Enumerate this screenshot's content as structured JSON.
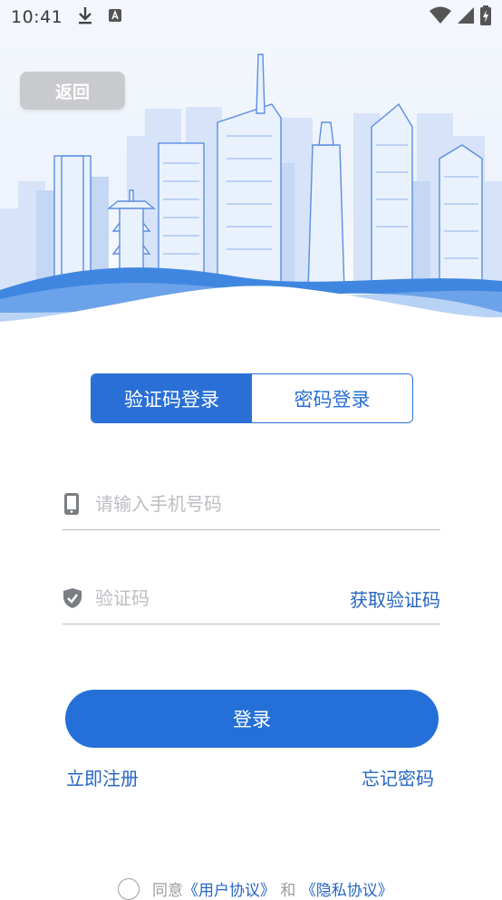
{
  "status_bar": {
    "time": "10:41",
    "icons_left": [
      "download-icon",
      "a-notification-icon"
    ],
    "icons_right": [
      "wifi-icon",
      "cell-signal-icon",
      "battery-charging-icon"
    ]
  },
  "header": {
    "back_label": "返回"
  },
  "tabs": [
    {
      "label": "验证码登录",
      "active": true
    },
    {
      "label": "密码登录",
      "active": false
    }
  ],
  "form": {
    "phone": {
      "placeholder": "请输入手机号码",
      "value": "",
      "icon": "phone-icon"
    },
    "code": {
      "placeholder": "验证码",
      "value": "",
      "icon": "shield-check-icon",
      "action_label": "获取验证码"
    }
  },
  "login_label": "登录",
  "links": {
    "register": "立即注册",
    "forgot": "忘记密码"
  },
  "agreement": {
    "prefix": "同意",
    "user_protocol": "《用户协议》",
    "conjunction": "和",
    "privacy_protocol": "《隐私协议》"
  },
  "colors": {
    "primary": "#2470d8",
    "link": "#2566c4",
    "back_button": "#c9cacd"
  }
}
